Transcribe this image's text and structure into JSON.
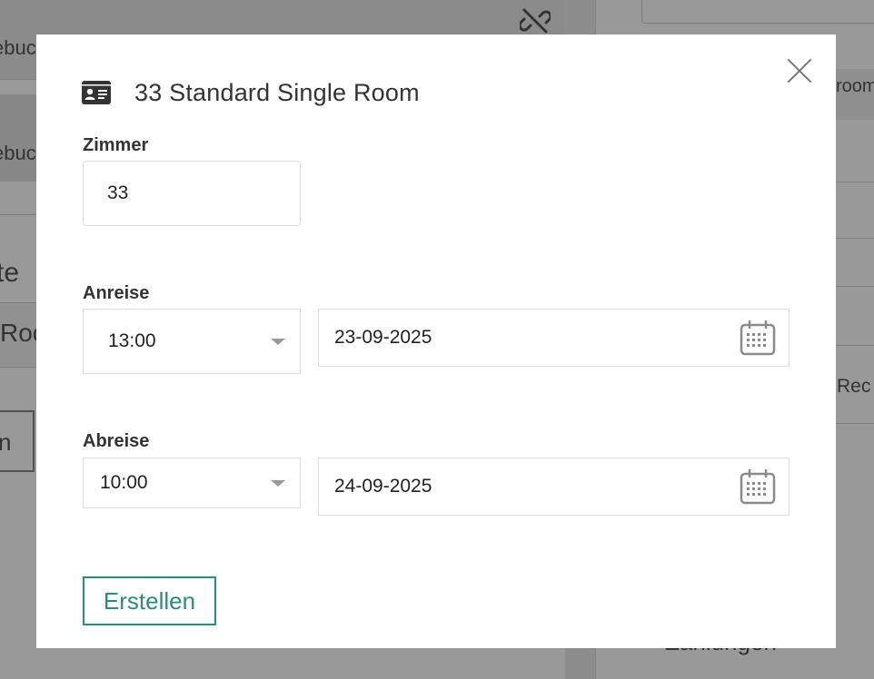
{
  "background": {
    "left_text_1": "ebuc",
    "left_text_2": "ebuc",
    "left_text_3": "te",
    "left_text_4": "Roo",
    "left_text_5": "n",
    "right_text_1": "room",
    "right_text_2": "Rec",
    "right_text_3": "Zahlungen"
  },
  "modal": {
    "title": "33 Standard Single Room",
    "title_icon": "id-card-icon",
    "close_icon": "close-icon",
    "room": {
      "label": "Zimmer",
      "value": "33"
    },
    "arrival": {
      "label": "Anreise",
      "time": "13:00",
      "date": "23-09-2025"
    },
    "departure": {
      "label": "Abreise",
      "time": "10:00",
      "date": "24-09-2025"
    },
    "submit_label": "Erstellen",
    "colors": {
      "accent": "#2e8b7a",
      "text": "#333333",
      "border": "#dddddd"
    }
  }
}
